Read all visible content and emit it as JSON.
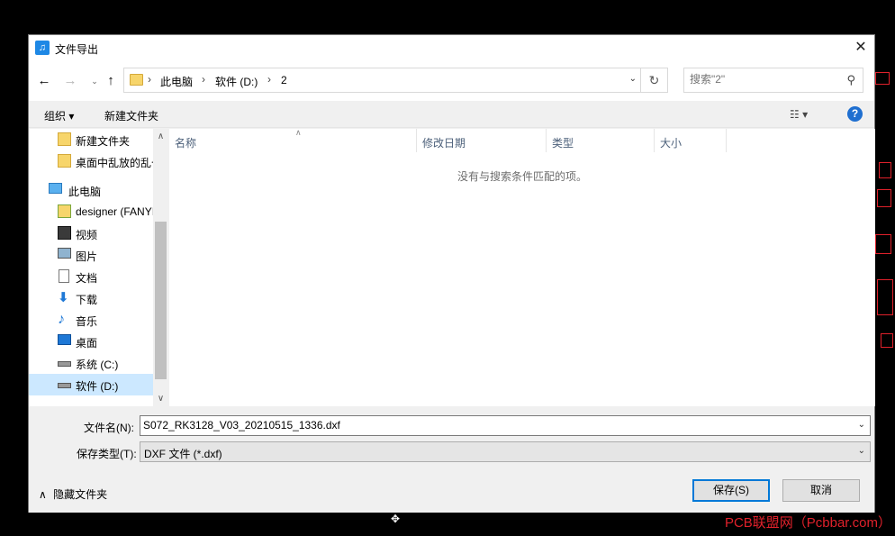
{
  "window": {
    "title": "文件导出"
  },
  "nav": {
    "breadcrumbs": [
      "此电脑",
      "软件 (D:)",
      "2"
    ],
    "search_placeholder": "搜索\"2\""
  },
  "toolbar": {
    "organize": "组织 ▾",
    "new_folder": "新建文件夹"
  },
  "sidebar": {
    "items": [
      {
        "label": "新建文件夹",
        "icon": "folder-icon"
      },
      {
        "label": "桌面中乱放的乱七八糟",
        "icon": "folder-icon"
      },
      {
        "label": "此电脑",
        "icon": "computer-icon"
      },
      {
        "label": "designer (FANYI",
        "icon": "network-user-icon"
      },
      {
        "label": "视频",
        "icon": "video-icon"
      },
      {
        "label": "图片",
        "icon": "picture-icon"
      },
      {
        "label": "文档",
        "icon": "document-icon"
      },
      {
        "label": "下载",
        "icon": "download-icon"
      },
      {
        "label": "音乐",
        "icon": "music-icon"
      },
      {
        "label": "桌面",
        "icon": "desktop-icon"
      },
      {
        "label": "系统 (C:)",
        "icon": "drive-icon"
      },
      {
        "label": "软件 (D:)",
        "icon": "drive-icon"
      }
    ]
  },
  "file_list": {
    "columns": [
      "名称",
      "修改日期",
      "类型",
      "大小"
    ],
    "empty_message": "没有与搜索条件匹配的项。"
  },
  "form": {
    "filename_label": "文件名(N):",
    "filename_value": "S072_RK3128_V03_20210515_1336.dxf",
    "filetype_label": "保存类型(T):",
    "filetype_value": "DXF 文件 (*.dxf)"
  },
  "footer": {
    "hide_folders": "隐藏文件夹",
    "save": "保存(S)",
    "cancel": "取消"
  },
  "watermark": "PCB联盟网（Pcbbar.com）",
  "colors": {
    "accent": "#0078d7",
    "help": "#1f6fd0",
    "selected": "#cce8ff",
    "pcb_red": "#e0212b"
  }
}
